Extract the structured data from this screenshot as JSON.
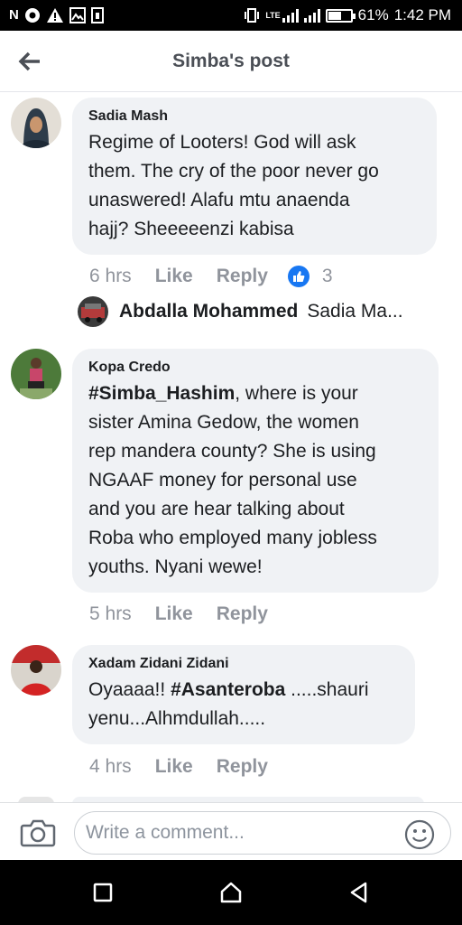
{
  "status_bar": {
    "left_icons": [
      "N",
      "chrome-icon",
      "warning-icon",
      "image-icon",
      "sim-icon"
    ],
    "network": "LTE",
    "battery": "61%",
    "battery_level": 0.61,
    "time": "1:42 PM"
  },
  "header": {
    "title": "Simba's post"
  },
  "comments": [
    {
      "author": "Sadia Mash",
      "lines": [
        "Regime of Looters! God will ask",
        "them. The cry of the poor never go",
        "unaswered! Alafu mtu anaenda",
        "hajj? Sheeeeenzi kabisa"
      ],
      "time": "6 hrs",
      "like": "Like",
      "reply": "Reply",
      "reactions": "3",
      "reply_preview": {
        "name": "Abdalla Mohammed",
        "text": "Sadia Ma..."
      }
    },
    {
      "author": "Kopa Credo",
      "hashtag": "#Simba_Hashim",
      "first_line_rest": ", where is your",
      "lines": [
        "sister  Amina Gedow, the women",
        "rep mandera county?  She is using",
        "NGAAF money for personal use",
        "and you are hear talking about",
        "Roba who employed many jobless",
        "youths. Nyani wewe!"
      ],
      "time": "5 hrs",
      "like": "Like",
      "reply": "Reply"
    },
    {
      "author": "Xadam Zidani Zidani",
      "first_pre": "Oyaaaa!! ",
      "hashtag": "#Asanteroba",
      "first_post": " .....shauri",
      "lines": [
        "yenu...Alhmdullah....."
      ],
      "time": "4 hrs",
      "like": "Like",
      "reply": "Reply"
    }
  ],
  "composer": {
    "placeholder": "Write a comment..."
  },
  "colors": {
    "accent": "#1877f2",
    "bubble": "#f0f2f5",
    "meta": "#90949c"
  }
}
